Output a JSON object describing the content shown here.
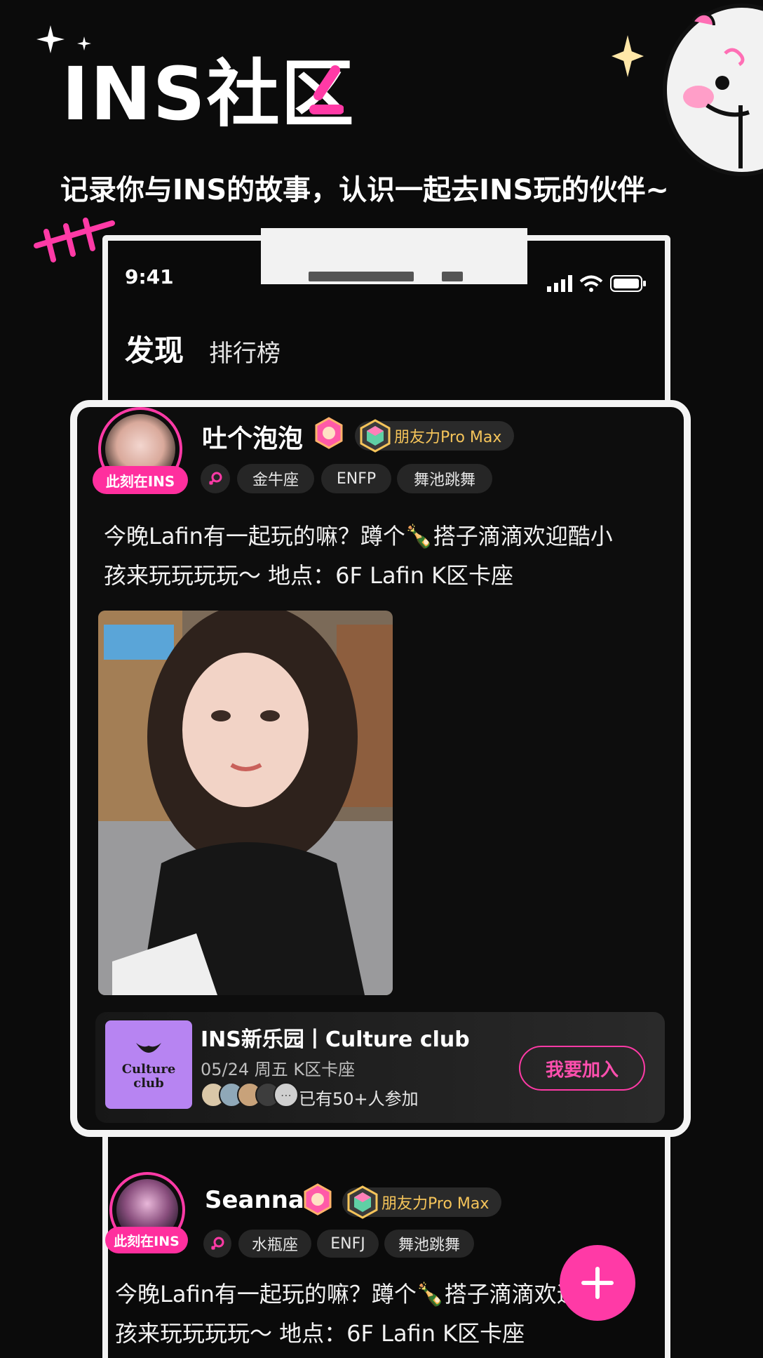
{
  "header": {
    "headline": "INS社区",
    "subtitle": "记录你与INS的故事，认识一起去INS玩的伙伴~"
  },
  "status_bar": {
    "time": "9:41"
  },
  "tabs": [
    {
      "label": "发现"
    },
    {
      "label": "排行榜"
    }
  ],
  "posts": [
    {
      "username": "吐个泡泡",
      "ins_badge": "此刻在INS",
      "friend_level": "朋友力Pro Max",
      "tags": [
        "金牛座",
        "ENFP",
        "舞池跳舞"
      ],
      "text_lines": [
        "今晚Lafin有一起玩的嘛？蹲个🍾搭子滴滴欢迎酷小",
        "孩来玩玩玩玩～ 地点：6F Lafin K区卡座"
      ],
      "event": {
        "title": "INS新乐园丨Culture club",
        "date": "05/24 周五 K区卡座",
        "participants": "已有50+人参加",
        "join_label": "我要加入",
        "logo_text": "Culture club"
      }
    },
    {
      "username": "Seanna",
      "ins_badge": "此刻在INS",
      "friend_level": "朋友力Pro Max",
      "tags": [
        "水瓶座",
        "ENFJ",
        "舞池跳舞"
      ],
      "text_lines": [
        "今晚Lafin有一起玩的嘛？蹲个🍾搭子滴滴欢迎",
        "孩来玩玩玩玩～ 地点：6F Lafin K区卡座"
      ]
    }
  ],
  "colors": {
    "accent": "#ff3aa6",
    "background": "#0b0b0b",
    "gold": "#f5c45a"
  },
  "icons": [
    "sparkle-icon",
    "signal-icon",
    "wifi-icon",
    "battery-icon",
    "level-badge-icon",
    "gem-icon",
    "female-icon",
    "plus-icon"
  ]
}
